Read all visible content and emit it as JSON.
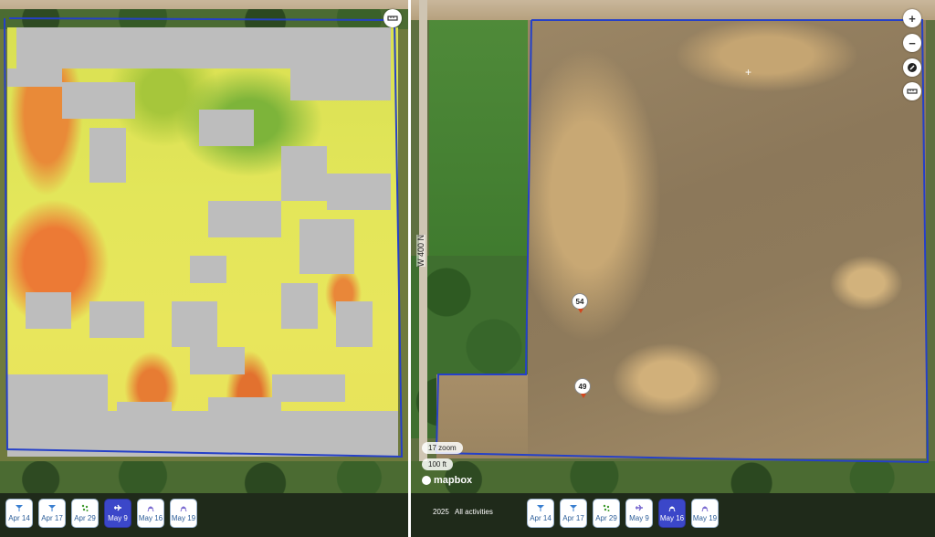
{
  "left_map": {
    "dates": [
      {
        "label": "Apr 14",
        "icon": "satellite-icon",
        "active": false
      },
      {
        "label": "Apr 17",
        "icon": "satellite-icon",
        "active": false
      },
      {
        "label": "Apr 29",
        "icon": "scatter-icon",
        "active": false
      },
      {
        "label": "May 9",
        "icon": "plane-icon",
        "active": true
      },
      {
        "label": "May 16",
        "icon": "drone-icon",
        "active": false
      },
      {
        "label": "May 19",
        "icon": "drone-icon",
        "active": false
      }
    ]
  },
  "right_map": {
    "road_label": "W 400 N",
    "markers": [
      "54",
      "49"
    ],
    "zoom_label": "17 zoom",
    "scale_label": "100 ft",
    "attribution": "mapbox",
    "year": "2025",
    "activities": "All activities",
    "dates": [
      {
        "label": "Apr 14",
        "icon": "satellite-icon",
        "active": false
      },
      {
        "label": "Apr 17",
        "icon": "satellite-icon",
        "active": false
      },
      {
        "label": "Apr 29",
        "icon": "scatter-icon",
        "active": false
      },
      {
        "label": "May 9",
        "icon": "plane-icon",
        "active": false
      },
      {
        "label": "May 16",
        "icon": "drone-icon",
        "active": true
      },
      {
        "label": "May 19",
        "icon": "drone-icon",
        "active": false
      }
    ]
  },
  "controls": {
    "zoom_in": "+",
    "zoom_out": "−"
  },
  "colors": {
    "boundary": "#2540c8",
    "active_chip": "#3b47c9",
    "chip_text": "#2b5d98",
    "ndvi_low": "#e98a38",
    "ndvi_mid": "#e3e65a",
    "ndvi_high": "#3f9a2e",
    "no_data": "#bdbdbd"
  }
}
